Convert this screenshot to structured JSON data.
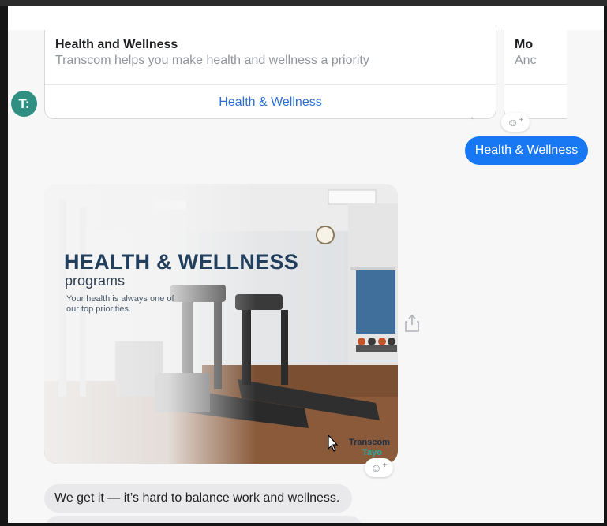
{
  "carousel": {
    "cards": [
      {
        "title": "Health and Wellness",
        "subtitle": "Transcom helps you make health and wellness a priority",
        "button_label": "Health & Wellness"
      },
      {
        "title": "Mo",
        "subtitle": "Anc"
      }
    ]
  },
  "avatar": {
    "initials": "T:",
    "color": "#2e8f82"
  },
  "sent_message": {
    "text": "Health & Wellness",
    "color": "#1877f2"
  },
  "image_card": {
    "title": "HEALTH & WELLNESS",
    "subtitle": "programs",
    "tagline": "Your health is always one of our top priorities.",
    "brand_line1": "Transcom",
    "brand_line2": "Tayo"
  },
  "received_messages": [
    {
      "text": "We get it — it’s hard to balance work and wellness."
    }
  ],
  "icons": {
    "react": "smiley-plus-icon",
    "share": "share-icon",
    "cursor": "mouse-cursor-icon"
  }
}
